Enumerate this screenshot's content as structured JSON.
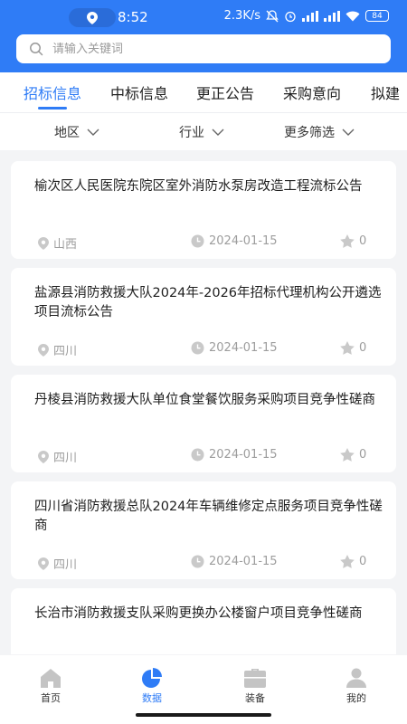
{
  "status_bar": {
    "time": "8:52",
    "speed": "2.3K/s",
    "battery": "84"
  },
  "search": {
    "placeholder": "请输入关键词"
  },
  "tabs": [
    {
      "label": "招标信息",
      "active": true
    },
    {
      "label": "中标信息",
      "active": false
    },
    {
      "label": "更正公告",
      "active": false
    },
    {
      "label": "采购意向",
      "active": false
    },
    {
      "label": "拟建",
      "active": false
    }
  ],
  "filters": [
    {
      "label": "地区"
    },
    {
      "label": "行业"
    },
    {
      "label": "更多筛选"
    }
  ],
  "items": [
    {
      "title": "榆次区人民医院东院区室外消防水泵房改造工程流标公告",
      "region": "山西",
      "date": "2024-01-15",
      "favorites": "0"
    },
    {
      "title": "盐源县消防救援大队2024年-2026年招标代理机构公开遴选项目流标公告",
      "region": "四川",
      "date": "2024-01-15",
      "favorites": "0"
    },
    {
      "title": "丹棱县消防救援大队单位食堂餐饮服务采购项目竞争性磋商",
      "region": "四川",
      "date": "2024-01-15",
      "favorites": "0"
    },
    {
      "title": "四川省消防救援总队2024年车辆维修定点服务项目竞争性磋商",
      "region": "四川",
      "date": "2024-01-15",
      "favorites": "0"
    },
    {
      "title": "长治市消防救援支队采购更换办公楼窗户项目竞争性磋商",
      "region": "",
      "date": "",
      "favorites": ""
    }
  ],
  "bottom_nav": [
    {
      "label": "首页",
      "icon": "home-icon",
      "active": false
    },
    {
      "label": "数据",
      "icon": "pie-chart-icon",
      "active": true
    },
    {
      "label": "装备",
      "icon": "briefcase-icon",
      "active": false
    },
    {
      "label": "我的",
      "icon": "user-icon",
      "active": false
    }
  ],
  "colors": {
    "accent": "#2f7cf6",
    "background": "#f3f4f6",
    "meta_gray": "#9d9d9d"
  }
}
